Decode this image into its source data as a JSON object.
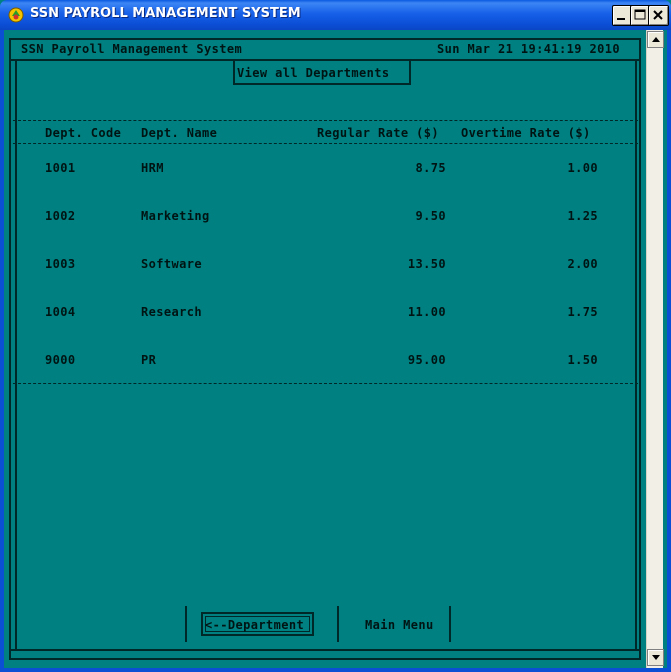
{
  "window": {
    "title": "SSN PAYROLL MANAGEMENT SYSTEM",
    "icon": "app-icon",
    "controls": [
      "minimize-icon",
      "maximize-icon",
      "close-icon"
    ]
  },
  "header": {
    "system_title": "SSN Payroll Management System",
    "datetime": "Sun Mar 21 19:41:19 2010"
  },
  "view_label": "View all Departments",
  "table": {
    "columns": [
      "Dept. Code",
      "Dept. Name",
      "Regular Rate ($)",
      "Overtime Rate ($)"
    ],
    "rows": [
      {
        "code": "1001",
        "name": "HRM",
        "regular": "8.75",
        "overtime": "1.00"
      },
      {
        "code": "1002",
        "name": "Marketing",
        "regular": "9.50",
        "overtime": "1.25"
      },
      {
        "code": "1003",
        "name": "Software",
        "regular": "13.50",
        "overtime": "2.00"
      },
      {
        "code": "1004",
        "name": "Research",
        "regular": "11.00",
        "overtime": "1.75"
      },
      {
        "code": "9000",
        "name": "PR",
        "regular": "95.00",
        "overtime": "1.50"
      }
    ]
  },
  "footer": {
    "department_button": "<--Department",
    "main_menu_button": "Main Menu"
  },
  "colors": {
    "background": "#008080",
    "text": "#001414",
    "titlebar": "#0a58e0"
  }
}
